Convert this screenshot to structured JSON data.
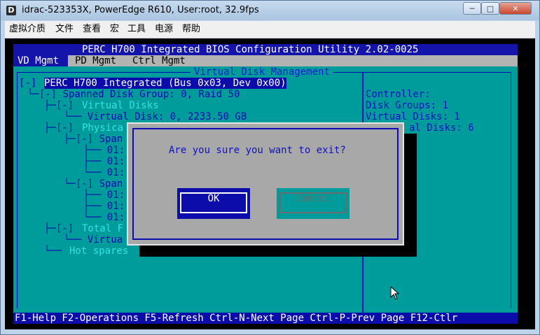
{
  "window": {
    "title": "idrac-523353X, PowerEdge R610, User:root, 32.9fps",
    "app_icon_letter": "D",
    "min_glyph": "─",
    "max_glyph": "□",
    "close_glyph": "✕"
  },
  "menubar": {
    "items": [
      "虚拟介质",
      "文件",
      "查看",
      "宏",
      "工具",
      "电源",
      "帮助"
    ]
  },
  "bios": {
    "title": "PERC H700 Integrated BIOS Configuration Utility 2.02-0025",
    "tabs": [
      "VD Mgmt",
      "PD Mgmt",
      "Ctrl Mgmt"
    ],
    "panel_title": "Virtual Disk Management",
    "tree": {
      "root": "PERC H700 Integrated (Bus 0x03, Dev 0x00)",
      "root_prefix": "[-]",
      "disk_group": "└─[-] Spanned Disk Group: 0, Raid 50",
      "virtual_disks_branch": "├─[-]",
      "virtual_disks_label": "Virtual Disks",
      "virtual_disk_line": "└── Virtual Disk: 0, 2233.50 GB",
      "physical_branch": "├─[-]",
      "physical_label": "Physica",
      "span1": "├─[-] Span",
      "span1_disks": [
        "├── 01:",
        "├── 01:",
        "└── 01:"
      ],
      "span2": "└─[-] Span",
      "span2_disks": [
        "├── 01:",
        "├── 01:",
        "└── 01:"
      ],
      "total_branch": "├─[-]",
      "total_label": "Total F",
      "virtual_line": "└── Virtua",
      "hot_spares_branch": "└──",
      "hot_spares_label": "Hot spares"
    },
    "info": {
      "controller_label": "Controller:",
      "disk_groups": "Disk Groups: 1",
      "virtual_disks": "Virtual Disks: 1",
      "physical_disks_partial": "al Disks: 6"
    },
    "footer": "F1-Help F2-Operations F5-Refresh Ctrl-N-Next Page Ctrl-P-Prev Page F12-Ctlr",
    "dialog": {
      "message": "Are you sure you want to exit?",
      "ok": "OK",
      "cancel": "Cancel"
    }
  },
  "colors": {
    "bios_blue": "#0c0caa",
    "panel_cyan": "#009c9c",
    "dialog_gray": "#a8a8a8",
    "highlight_cyan": "#33e3e3"
  }
}
